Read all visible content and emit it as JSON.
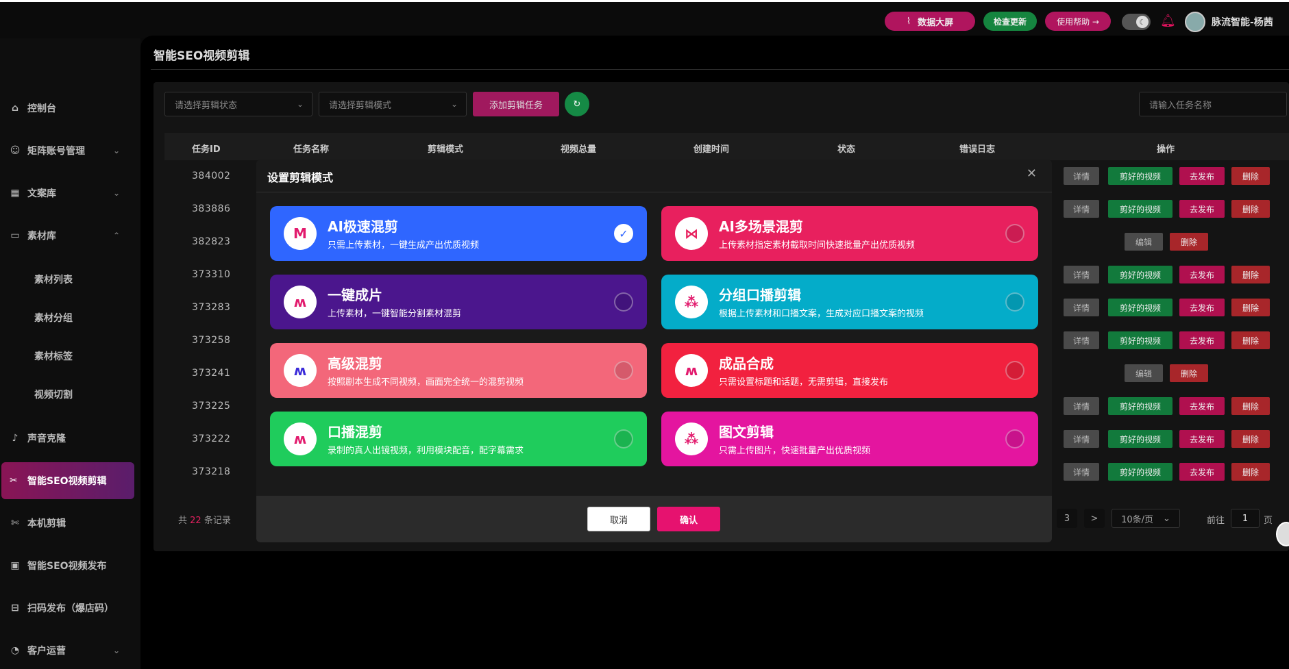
{
  "topbar": {
    "data_screen": "数据大屏",
    "check_update": "检查更新",
    "help": "使用帮助 →",
    "username": "脉流智能-杨茜"
  },
  "sidebar": {
    "items": [
      {
        "label": "控制台",
        "icon": "home-icon"
      },
      {
        "label": "矩阵账号管理",
        "icon": "user-circle-icon"
      },
      {
        "label": "文案库",
        "icon": "table-icon"
      },
      {
        "label": "素材库",
        "icon": "folder-icon"
      },
      {
        "label": "声音克隆",
        "icon": "mic-icon"
      },
      {
        "label": "智能SEO视频剪辑",
        "icon": "scissors-icon"
      },
      {
        "label": "本机剪辑",
        "icon": "cut-icon"
      },
      {
        "label": "智能SEO视频发布",
        "icon": "video-icon"
      },
      {
        "label": "扫码发布（爆店码）",
        "icon": "qr-icon"
      },
      {
        "label": "客户运营",
        "icon": "chart-icon"
      }
    ],
    "sub_items": [
      "素材列表",
      "素材分组",
      "素材标签",
      "视频切割"
    ]
  },
  "page": {
    "title": "智能SEO视频剪辑"
  },
  "toolbar": {
    "status_placeholder": "请选择剪辑状态",
    "mode_placeholder": "请选择剪辑模式",
    "add_task": "添加剪辑任务",
    "search_placeholder": "请输入任务名称"
  },
  "table": {
    "headers": [
      "任务ID",
      "任务名称",
      "剪辑模式",
      "视频总量",
      "创建时间",
      "状态",
      "错误日志",
      "操作"
    ],
    "ids": [
      "384002",
      "383886",
      "382823",
      "373310",
      "373283",
      "373258",
      "373241",
      "373225",
      "373222",
      "373218"
    ],
    "actions": {
      "detail": "详情",
      "videos": "剪好的视频",
      "publish": "去发布",
      "delete": "删除",
      "edit": "编辑"
    }
  },
  "footer": {
    "total_prefix": "共",
    "total": "22",
    "total_suffix": "条记录",
    "page_3": "3",
    "next": ">",
    "page_size": "10条/页",
    "goto_label": "前往",
    "goto_value": "1",
    "page_unit": "页"
  },
  "modal": {
    "title": "设置剪辑模式",
    "options": [
      {
        "title": "AI极速混剪",
        "desc": "只需上传素材，一键生成产出优质视频",
        "color": "#2f66ff",
        "selected": true
      },
      {
        "title": "AI多场景混剪",
        "desc": "上传素材指定素材截取时间快速批量产出优质视频",
        "color": "#e8205e",
        "selected": false
      },
      {
        "title": "一键成片",
        "desc": "上传素材，一键智能分割素材混剪",
        "color": "#4b168d",
        "selected": false
      },
      {
        "title": "分组口播剪辑",
        "desc": "根据上传素材和口播文案，生成对应口播文案的视频",
        "color": "#04acc9",
        "selected": false
      },
      {
        "title": "高级混剪",
        "desc": "按照剧本生成不同视频，画面完全统一的混剪视频",
        "color": "#f3677a",
        "selected": false
      },
      {
        "title": "成品合成",
        "desc": "只需设置标题和话题，无需剪辑，直接发布",
        "color": "#f2213f",
        "selected": false
      },
      {
        "title": "口播混剪",
        "desc": "录制的真人出镜视频，利用模块配音，配字幕需求",
        "color": "#1fcc5c",
        "selected": false
      },
      {
        "title": "图文剪辑",
        "desc": "只需上传图片，快速批量产出优质视频",
        "color": "#e4159f",
        "selected": false
      }
    ],
    "cancel": "取消",
    "confirm": "确认"
  }
}
